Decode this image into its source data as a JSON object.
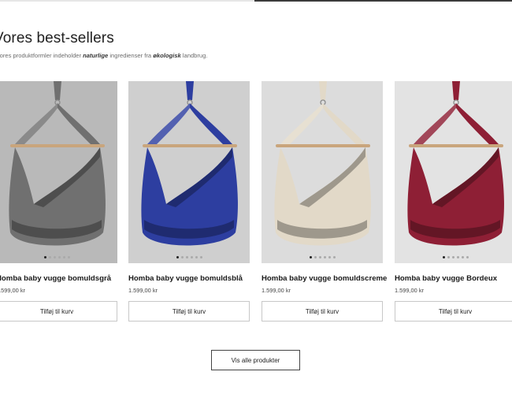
{
  "section": {
    "title": "Vores best-sellers",
    "subtitle": {
      "part1": "Vores produktformler indeholder ",
      "em1": "naturlige",
      "part2": " ingredienser fra ",
      "em2": "økologisk",
      "part3": " landbrug."
    }
  },
  "products": [
    {
      "name": "Homba baby vugge bomuldsgrå",
      "price": "1.599,00 kr",
      "add_label": "Tilføj til kurv",
      "color": "#707070",
      "background": "#b9b9b9",
      "active_dot": 1
    },
    {
      "name": "Homba baby vugge bomuldsblå",
      "price": "1.599,00 kr",
      "add_label": "Tilføj til kurv",
      "color": "#2d3ea0",
      "background": "#cfcfcf",
      "active_dot": 1
    },
    {
      "name": "Homba baby vugge bomuldscreme",
      "price": "1.599,00 kr",
      "add_label": "Tilføj til kurv",
      "color": "#e2d9c8",
      "background": "#dcdcdc",
      "active_dot": 1
    },
    {
      "name": "Homba baby vugge Bordeux",
      "price": "1.599,00 kr",
      "add_label": "Tilføj til kurv",
      "color": "#8e1f35",
      "background": "#e3e3e3",
      "active_dot": 1
    }
  ],
  "carousel": {
    "dot_count": 6
  },
  "view_all_label": "Vis alle produkter"
}
